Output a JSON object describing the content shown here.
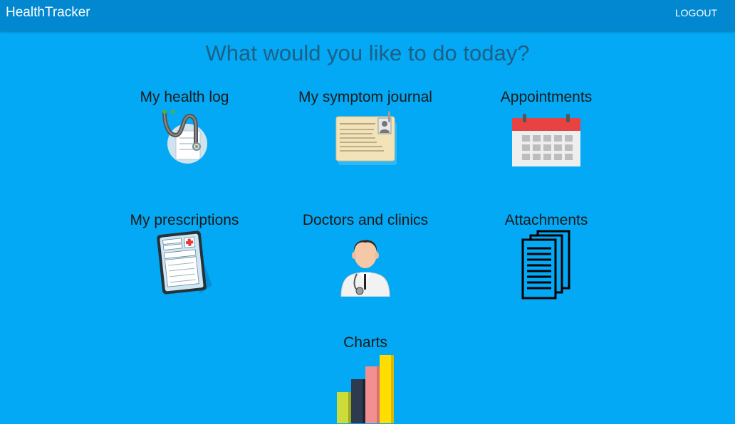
{
  "navbar": {
    "brand": "HealthTracker",
    "logout_label": "LOGOUT"
  },
  "main": {
    "heading": "What would you like to do today?",
    "tiles": [
      {
        "label": "My health log",
        "icon": "stethoscope-icon"
      },
      {
        "label": "My symptom journal",
        "icon": "journal-card-icon"
      },
      {
        "label": "Appointments",
        "icon": "calendar-icon"
      },
      {
        "label": "My prescriptions",
        "icon": "prescription-icon"
      },
      {
        "label": "Doctors and clinics",
        "icon": "doctor-icon"
      },
      {
        "label": "Attachments",
        "icon": "documents-icon"
      },
      {
        "label": "Charts",
        "icon": "bar-chart-icon"
      }
    ]
  },
  "colors": {
    "background": "#03a9f4",
    "navbar": "#0288d1",
    "heading": "#1d5f86"
  }
}
